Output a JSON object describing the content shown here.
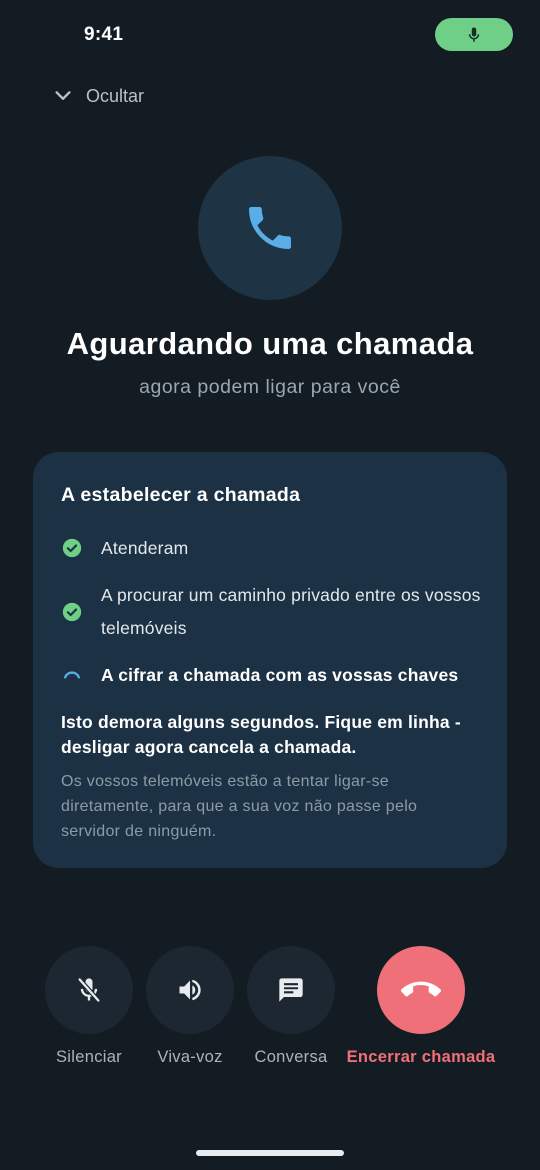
{
  "status_bar": {
    "time": "9:41",
    "indicator_icon": "mic-icon",
    "indicator_color": "#6fcf86"
  },
  "header": {
    "hide_label": "Ocultar",
    "hide_icon": "chevron-down-icon"
  },
  "call": {
    "icon": "phone-icon",
    "title": "Aguardando uma chamada",
    "subtitle": "agora podem ligar para você"
  },
  "card": {
    "title": "A estabelecer a chamada",
    "steps": [
      {
        "label": "Atenderam",
        "state": "done",
        "icon": "check-circle-icon"
      },
      {
        "label": "A procurar um caminho privado entre os vossos telemóveis",
        "state": "done",
        "icon": "check-circle-icon"
      },
      {
        "label": "A cifrar a chamada com as vossas chaves",
        "state": "in-progress",
        "icon": "spinner-icon"
      }
    ],
    "note_bold": "Isto demora alguns segundos. Fique em linha - desligar agora cancela a chamada.",
    "note_muted": "Os vossos telemóveis estão a tentar ligar-se diretamente, para que a sua voz não passe pelo servidor de ninguém."
  },
  "controls": [
    {
      "label": "Silenciar",
      "icon": "mic-off-icon"
    },
    {
      "label": "Viva-voz",
      "icon": "speaker-icon"
    },
    {
      "label": "Conversa",
      "icon": "chat-icon"
    },
    {
      "label": "Encerrar chamada",
      "icon": "hang-up-icon"
    }
  ],
  "colors": {
    "background": "#141c23",
    "card": "#1c3244",
    "success": "#6fcf86",
    "danger": "#ef7078",
    "accent": "#5aaee8"
  }
}
